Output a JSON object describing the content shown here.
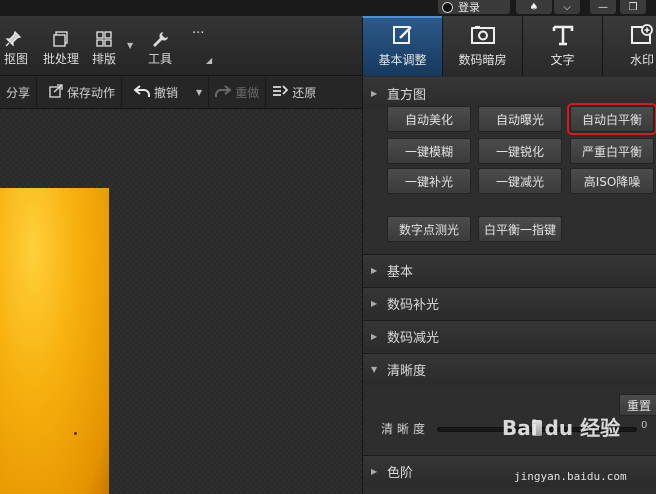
{
  "titlebar": {
    "login": "登录",
    "btn_a": "♠",
    "btn_b": "⌵",
    "minimize": "—",
    "restore": "❐"
  },
  "toolbar": {
    "tools": [
      {
        "label": "抠图",
        "icon": "pin-icon"
      },
      {
        "label": "批处理",
        "icon": "stack-icon"
      },
      {
        "label": "排版",
        "icon": "grid-icon"
      },
      {
        "label": "工具",
        "icon": "wrench-icon"
      }
    ],
    "more": "···"
  },
  "tabs": [
    {
      "label": "基本调整",
      "icon": "edit-icon",
      "active": true
    },
    {
      "label": "数码暗房",
      "icon": "camera-icon",
      "active": false
    },
    {
      "label": "文字",
      "icon": "text-icon",
      "active": false
    },
    {
      "label": "水印",
      "icon": "add-watermark-icon",
      "active": false
    }
  ],
  "editbar": {
    "share": "分享",
    "save_action": "保存动作",
    "undo": "撤销",
    "redo": "重做",
    "restore": "还原"
  },
  "panel": {
    "histogram": "直方图",
    "buttons": [
      "自动美化",
      "自动曝光",
      "自动白平衡",
      "一键模糊",
      "一键锐化",
      "严重白平衡",
      "一键补光",
      "一键减光",
      "高ISO降噪"
    ],
    "buttons2": [
      "数字点测光",
      "白平衡一指键"
    ],
    "highlighted_button": "自动白平衡",
    "sections": [
      "基本",
      "数码补光",
      "数码减光",
      "清晰度",
      "色阶"
    ],
    "sharpness": {
      "reset": "重置",
      "label": "清晰度",
      "value": "0",
      "level": 0.5
    }
  },
  "watermark": {
    "brand": "Bai du 经验",
    "url": "jingyan.baidu.com"
  },
  "colors": {
    "accent": "#2c5a8a",
    "highlight": "#e0141e",
    "photo": "#f7b10e"
  }
}
